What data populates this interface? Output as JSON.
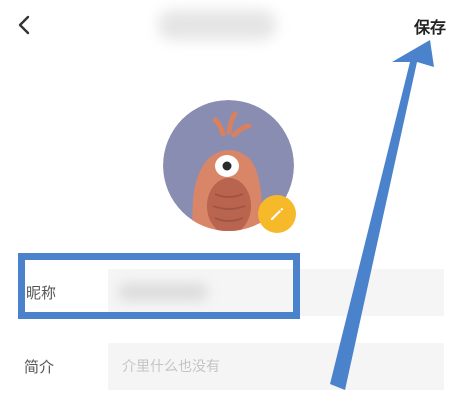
{
  "header": {
    "back_icon": "chevron-left-icon",
    "save_label": "保存"
  },
  "profile": {
    "avatar_icon": "cartoon-creature-avatar",
    "edit_icon": "pencil-icon",
    "edit_color": "#f5b92a"
  },
  "fields": {
    "nickname_label": "昵称",
    "bio_label": "简介",
    "bio_placeholder": "介里什么也没有"
  },
  "annotations": {
    "highlight_color": "#4a82cc",
    "arrow_icon": "arrow-up-icon"
  }
}
